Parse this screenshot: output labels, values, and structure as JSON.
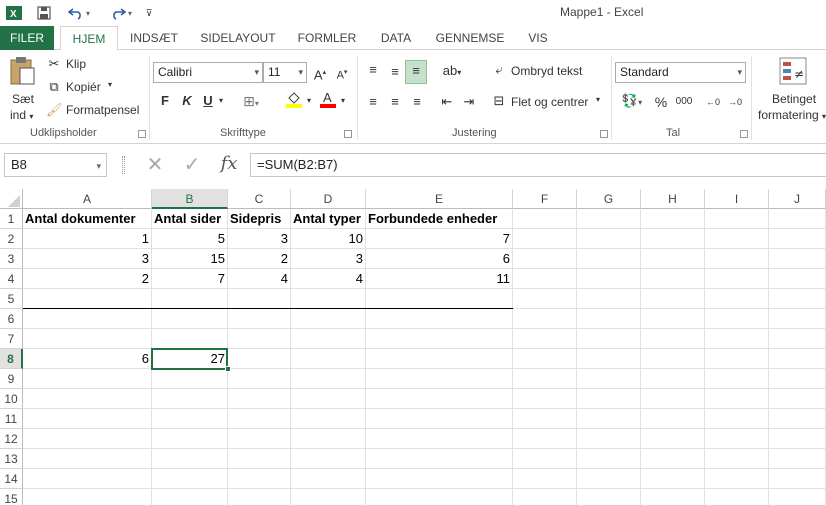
{
  "window": {
    "title": "Mappe1 - Excel",
    "qat": {
      "save_icon": "save-icon",
      "undo_icon": "undo-icon",
      "redo_icon": "redo-icon"
    }
  },
  "tabs": [
    {
      "label": "FILER"
    },
    {
      "label": "HJEM"
    },
    {
      "label": "INDSÆT"
    },
    {
      "label": "SIDELAYOUT"
    },
    {
      "label": "FORMLER"
    },
    {
      "label": "DATA"
    },
    {
      "label": "GENNEMSE"
    },
    {
      "label": "VIS"
    }
  ],
  "ribbon": {
    "clipboard": {
      "paste_label_1": "Sæt",
      "paste_label_2": "ind",
      "cut_label": "Klip",
      "copy_label": "Kopiér",
      "format_painter_label": "Formatpensel",
      "group_label": "Udklipsholder"
    },
    "font": {
      "font_name": "Calibri",
      "font_size": "11",
      "bold": "F",
      "italic": "K",
      "underline": "U",
      "group_label": "Skrifttype",
      "fill_color": "#ffff00",
      "font_color": "#ff0000"
    },
    "alignment": {
      "wrap_text_label": "Ombryd tekst",
      "merge_center_label": "Flet og centrer",
      "group_label": "Justering"
    },
    "number": {
      "format": "Standard",
      "percent": "%",
      "thousands": "000",
      "group_label": "Tal"
    },
    "styles": {
      "conditional_label_1": "Betinget",
      "conditional_label_2": "formatering"
    }
  },
  "formula_bar": {
    "name_box": "B8",
    "cancel_icon": "cancel-icon",
    "enter_icon": "enter-icon",
    "fx": "fx",
    "formula": "=SUM(B2:B7)"
  },
  "sheet": {
    "columns": [
      "A",
      "B",
      "C",
      "D",
      "E",
      "F",
      "G",
      "H",
      "I",
      "J"
    ],
    "rows": [
      "1",
      "2",
      "3",
      "4",
      "5",
      "6",
      "7",
      "8",
      "9",
      "10",
      "11",
      "12",
      "13",
      "14",
      "15"
    ],
    "selected_column": "B",
    "selected_row": "8",
    "headers": [
      "Antal dokumenter",
      "Antal sider",
      "Sidepris",
      "Antal typer",
      "Forbundede enheder"
    ],
    "data": [
      [
        "1",
        "5",
        "3",
        "10",
        "7"
      ],
      [
        "3",
        "15",
        "2",
        "3",
        "6"
      ],
      [
        "2",
        "7",
        "4",
        "4",
        "11"
      ]
    ],
    "row8": [
      "6",
      "27"
    ],
    "accent_color": "#217346"
  }
}
